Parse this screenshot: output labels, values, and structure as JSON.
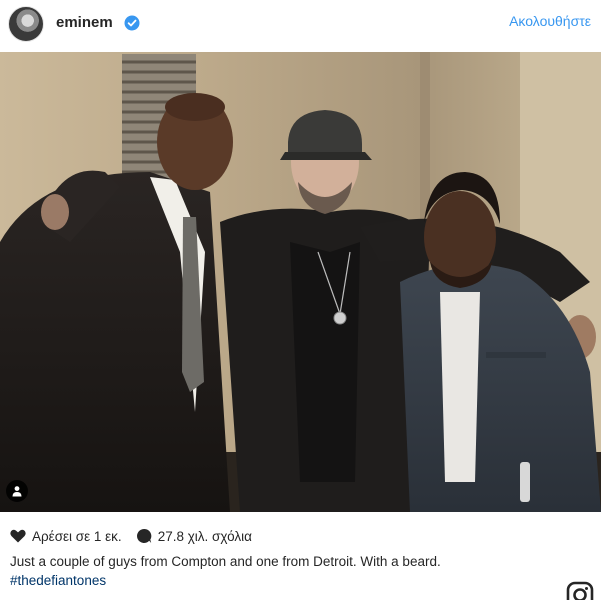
{
  "post": {
    "username": "eminem",
    "follow_label": "Ακολουθήστε",
    "likes_label": "Αρέσει σε 1 εκ.",
    "comments_label": "27.8 χιλ. σχόλια",
    "caption": "Just a couple of guys from Compton and one from Detroit. With a beard.",
    "hashtag": "#thedefiantones"
  },
  "colors": {
    "accent": "#3897f0",
    "verified": "#3897f0",
    "hashtag": "#003569",
    "text": "#262626"
  },
  "icons": {
    "verified": "verified-badge-icon",
    "user_tag": "user-tag-icon",
    "like": "heart-icon",
    "comment": "comment-bubble-icon",
    "brand": "instagram-icon"
  }
}
